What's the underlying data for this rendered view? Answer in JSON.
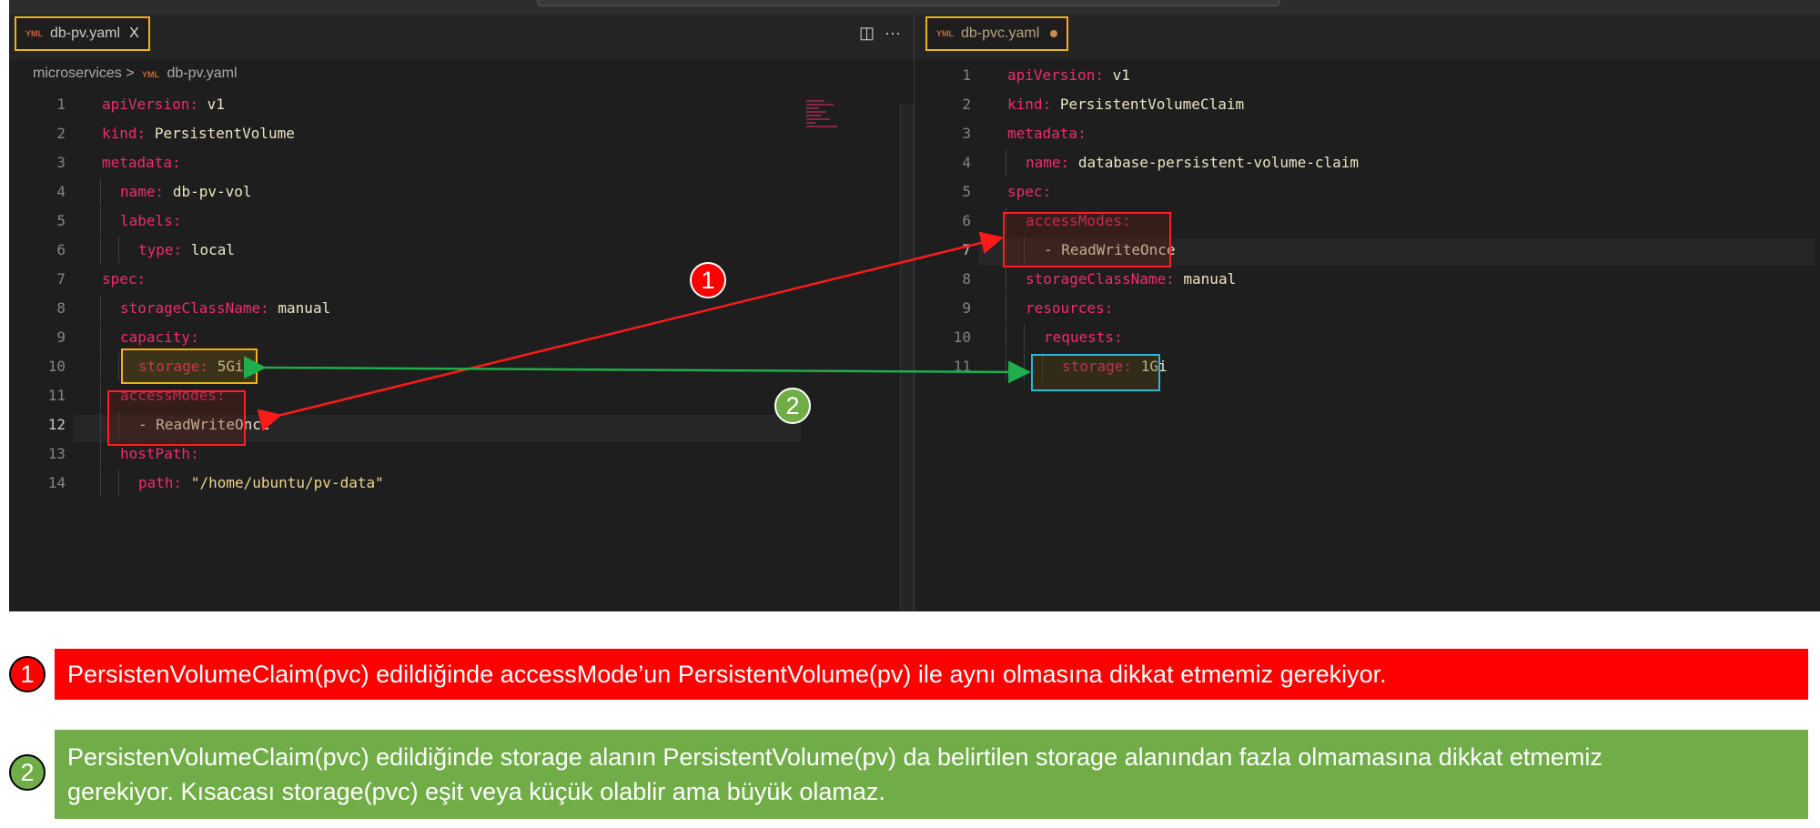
{
  "left_tab": {
    "label": "db-pv.yaml",
    "close": "X"
  },
  "right_tab": {
    "label": "db-pvc.yaml"
  },
  "breadcrumb": {
    "folder": "microservices",
    "sep": ">",
    "file": "db-pv.yaml"
  },
  "tab_actions": {
    "split": "◫",
    "more": "···"
  },
  "left_code": [
    {
      "n": "1",
      "indent": 0,
      "key": "apiVersion",
      "val": "v1"
    },
    {
      "n": "2",
      "indent": 0,
      "key": "kind",
      "val": "PersistentVolume"
    },
    {
      "n": "3",
      "indent": 0,
      "key": "metadata",
      "val": ""
    },
    {
      "n": "4",
      "indent": 1,
      "key": "name",
      "val": "db-pv-vol"
    },
    {
      "n": "5",
      "indent": 1,
      "key": "labels",
      "val": ""
    },
    {
      "n": "6",
      "indent": 2,
      "key": "type",
      "val": "local"
    },
    {
      "n": "7",
      "indent": 0,
      "key": "spec",
      "val": ""
    },
    {
      "n": "8",
      "indent": 1,
      "key": "storageClassName",
      "val": "manual"
    },
    {
      "n": "9",
      "indent": 1,
      "key": "capacity",
      "val": ""
    },
    {
      "n": "10",
      "indent": 2,
      "key": "storage",
      "val": "5Gi"
    },
    {
      "n": "11",
      "indent": 1,
      "key": "accessModes",
      "val": ""
    },
    {
      "n": "12",
      "indent": 2,
      "key": "- ReadWriteOnce",
      "val": "",
      "list": true
    },
    {
      "n": "13",
      "indent": 1,
      "key": "hostPath",
      "val": ""
    },
    {
      "n": "14",
      "indent": 2,
      "key": "path",
      "val": "\"/home/ubuntu/pv-data\""
    }
  ],
  "right_code": [
    {
      "n": "1",
      "indent": 0,
      "key": "apiVersion",
      "val": "v1"
    },
    {
      "n": "2",
      "indent": 0,
      "key": "kind",
      "val": "PersistentVolumeClaim"
    },
    {
      "n": "3",
      "indent": 0,
      "key": "metadata",
      "val": ""
    },
    {
      "n": "4",
      "indent": 1,
      "key": "name",
      "val": "database-persistent-volume-claim"
    },
    {
      "n": "5",
      "indent": 0,
      "key": "spec",
      "val": ""
    },
    {
      "n": "6",
      "indent": 1,
      "key": "accessModes",
      "val": ""
    },
    {
      "n": "7",
      "indent": 2,
      "key": "- ReadWriteOnce",
      "val": "",
      "list": true
    },
    {
      "n": "8",
      "indent": 1,
      "key": "storageClassName",
      "val": "manual"
    },
    {
      "n": "9",
      "indent": 1,
      "key": "resources",
      "val": ""
    },
    {
      "n": "10",
      "indent": 2,
      "key": "requests",
      "val": ""
    },
    {
      "n": "11",
      "indent": 3,
      "key": "storage",
      "val": "1Gi"
    }
  ],
  "callouts": [
    {
      "num": "1",
      "text": "PersistenVolumeClaim(pvc) edildiğinde accessMode’un PersistentVolume(pv) ile aynı olmasına dikkat etmemiz gerekiyor."
    },
    {
      "num": "2",
      "line1": "PersistenVolumeClaim(pvc) edildiğinde storage alanın PersistentVolume(pv) da belirtilen storage alanından fazla olmamasına dikkat etmemiz",
      "line2": "gerekiyor. Kısacası storage(pvc) eşit veya küçük olablir ama büyük olamaz."
    }
  ],
  "colors": {
    "red": "#ff0000",
    "green": "#70ad47",
    "arrow_green": "#1fae4b",
    "yellow_box": "#f2b01e",
    "cyan_box": "#29b6d8",
    "key": "#f02c6e",
    "value": "#eae6c2"
  },
  "icons": {
    "yaml": "yaml-file-icon"
  }
}
